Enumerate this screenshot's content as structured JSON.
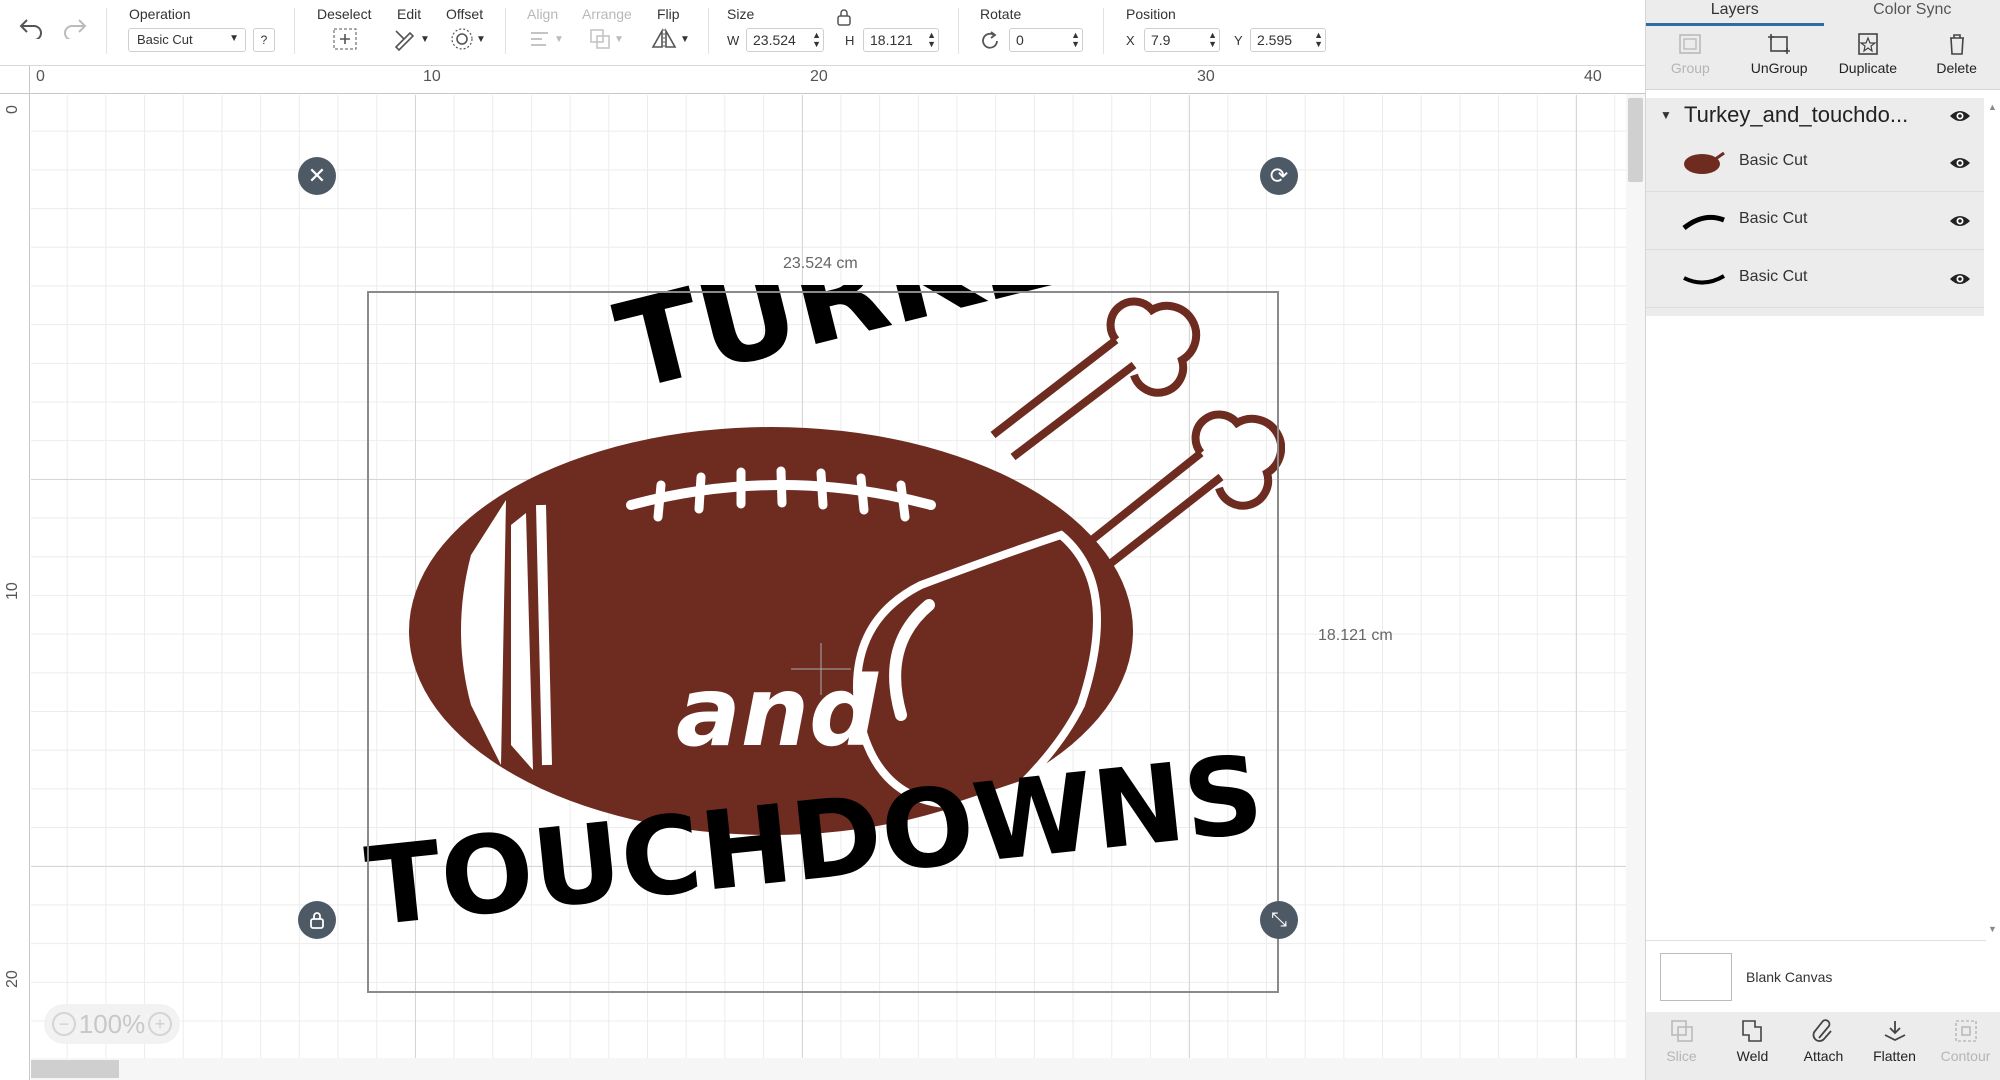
{
  "toolbar": {
    "operation_label": "Operation",
    "operation_value": "Basic Cut",
    "help_label": "?",
    "deselect_label": "Deselect",
    "edit_label": "Edit",
    "offset_label": "Offset",
    "align_label": "Align",
    "arrange_label": "Arrange",
    "flip_label": "Flip",
    "size_label": "Size",
    "w_label": "W",
    "w_value": "23.524",
    "h_label": "H",
    "h_value": "18.121",
    "rotate_label": "Rotate",
    "rotate_value": "0",
    "position_label": "Position",
    "x_label": "X",
    "x_value": "7.9",
    "y_label": "Y",
    "y_value": "2.595"
  },
  "ruler": {
    "top_ticks": [
      "0",
      "10",
      "20",
      "30",
      "40"
    ],
    "left_ticks": [
      "0",
      "10",
      "20"
    ]
  },
  "canvas": {
    "width_dim": "23.524 cm",
    "height_dim": "18.121 cm",
    "zoom_value": "100%",
    "zoom_minus": "−",
    "zoom_plus": "+",
    "design": {
      "top_word": "TURKEY",
      "middle_word": "and",
      "bottom_word": "TOUCHDOWNS",
      "ball_color": "#6e2b20",
      "text_color": "#000000"
    }
  },
  "panel": {
    "tabs": [
      "Layers",
      "Color Sync"
    ],
    "actions": [
      {
        "label": "Group",
        "icon": "group-icon",
        "enabled": false
      },
      {
        "label": "UnGroup",
        "icon": "ungroup-icon",
        "enabled": true
      },
      {
        "label": "Duplicate",
        "icon": "duplicate-icon",
        "enabled": true
      },
      {
        "label": "Delete",
        "icon": "trash-icon",
        "enabled": true
      }
    ],
    "group_name": "Turkey_and_touchdo...",
    "layers": [
      {
        "name": "Basic Cut",
        "thumb": "football-turkey"
      },
      {
        "name": "Basic Cut",
        "thumb": "turkey-text"
      },
      {
        "name": "Basic Cut",
        "thumb": "touchdowns-text"
      }
    ],
    "blank_canvas_label": "Blank Canvas",
    "bottom_actions": [
      {
        "label": "Slice",
        "icon": "slice-icon",
        "enabled": false
      },
      {
        "label": "Weld",
        "icon": "weld-icon",
        "enabled": true
      },
      {
        "label": "Attach",
        "icon": "attach-icon",
        "enabled": true
      },
      {
        "label": "Flatten",
        "icon": "flatten-icon",
        "enabled": true
      },
      {
        "label": "Contour",
        "icon": "contour-icon",
        "enabled": false
      }
    ]
  },
  "colors": {
    "accent": "#2e6da4",
    "handle": "#4d5a66",
    "ball": "#6e2b20"
  }
}
